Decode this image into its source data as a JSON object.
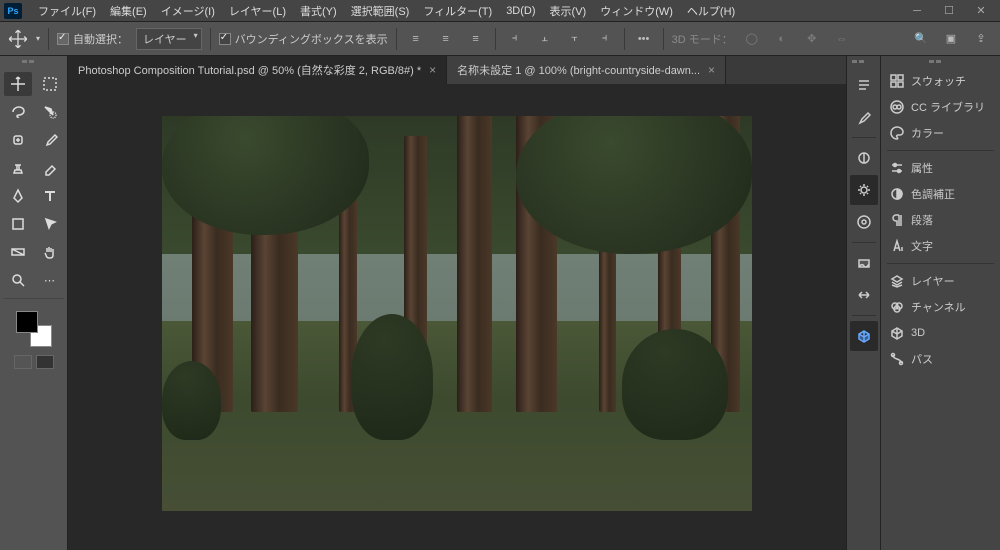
{
  "app": {
    "logo": "Ps"
  },
  "menu": [
    {
      "label": "ファイル(F)"
    },
    {
      "label": "編集(E)"
    },
    {
      "label": "イメージ(I)"
    },
    {
      "label": "レイヤー(L)"
    },
    {
      "label": "書式(Y)"
    },
    {
      "label": "選択範囲(S)"
    },
    {
      "label": "フィルター(T)"
    },
    {
      "label": "3D(D)"
    },
    {
      "label": "表示(V)"
    },
    {
      "label": "ウィンドウ(W)"
    },
    {
      "label": "ヘルプ(H)"
    }
  ],
  "options": {
    "auto_select_label": "自動選択：",
    "target_select": "レイヤー",
    "bounding_label": "バウンディングボックスを表示",
    "mode3d_label": "3D モード："
  },
  "tabs": [
    {
      "label": "Photoshop Composition Tutorial.psd @ 50% (自然な彩度 2, RGB/8#) *",
      "active": true
    },
    {
      "label": "名称未設定 1 @ 100% (bright-countryside-dawn...",
      "active": false
    }
  ],
  "panels": [
    {
      "label": "スウォッチ",
      "icon": "swatches"
    },
    {
      "label": "CC ライブラリ",
      "icon": "cc"
    },
    {
      "label": "カラー",
      "icon": "color"
    },
    {
      "div": true
    },
    {
      "label": "属性",
      "icon": "props"
    },
    {
      "label": "色調補正",
      "icon": "adjust"
    },
    {
      "label": "段落",
      "icon": "para"
    },
    {
      "label": "文字",
      "icon": "char"
    },
    {
      "div": true
    },
    {
      "label": "レイヤー",
      "icon": "layers"
    },
    {
      "label": "チャンネル",
      "icon": "channels"
    },
    {
      "label": "3D",
      "icon": "3d"
    },
    {
      "label": "パス",
      "icon": "path"
    }
  ]
}
